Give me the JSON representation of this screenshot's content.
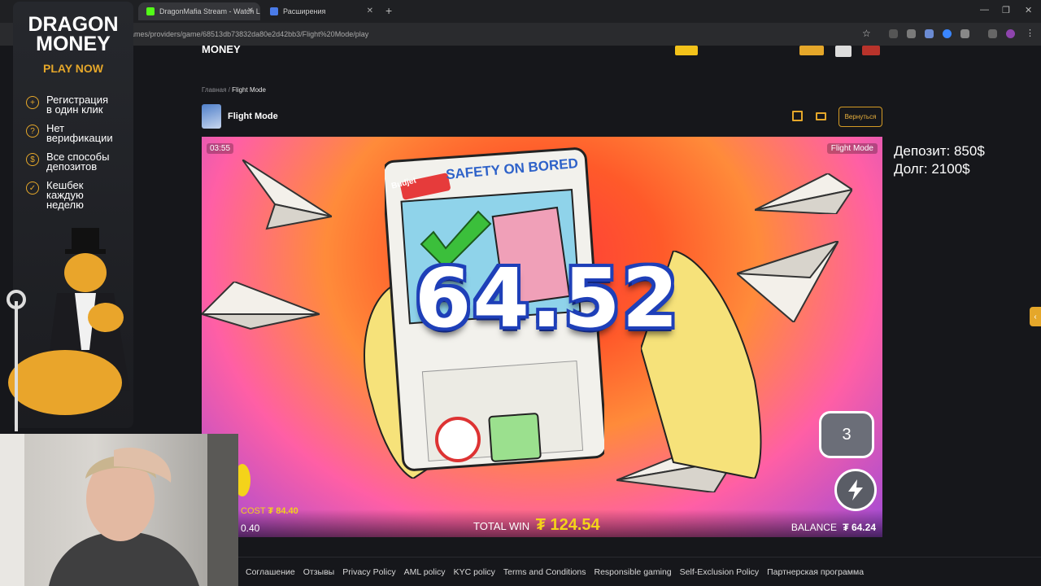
{
  "browser": {
    "tabs": [
      {
        "label": "DragonMafia Stream - Watch L",
        "favicon_color": "#53fc18"
      },
      {
        "label": "Расширения",
        "favicon_color": "#4a7be8"
      }
    ],
    "new_tab": "+",
    "url": "ames/providers/game/68513db73832da80e2d42bb3/Flight%20Mode/play"
  },
  "site": {
    "logo_text": "MONEY",
    "breadcrumb": {
      "home": "Главная",
      "separator": "/",
      "current": "Flight Mode"
    },
    "game_title": "Flight Mode",
    "back_label": "Вернуться",
    "accent": "#e5a72a"
  },
  "game": {
    "timer": "03:55",
    "label": "Flight Mode",
    "card_header": "SAFETY ON BORED",
    "card_brand": "Budjet",
    "multiplier": "64.52",
    "round_count": "3",
    "cost_label": "COST",
    "cost_value": "₮ 84.40",
    "bet_value": "0.40",
    "total_win_label": "TOTAL WIN",
    "total_win_value": "₮ 124.54",
    "balance_label": "BALANCE",
    "balance_value": "₮ 64.24"
  },
  "footer": {
    "links": [
      "Соглашение",
      "Отзывы",
      "Privacy Policy",
      "AML policy",
      "KYC policy",
      "Terms and Conditions",
      "Responsible gaming",
      "Self-Exclusion Policy",
      "Партнерская программа"
    ]
  },
  "overlay": {
    "deposit": "Депозит: 850$",
    "debt": "Долг: 2100$"
  },
  "promo": {
    "logo_line1": "DRAGON",
    "logo_line2": "MONEY",
    "cta": "PLAY NOW",
    "features": [
      {
        "icon": "plus-icon",
        "text": "Регистрация\nв один клик"
      },
      {
        "icon": "question-icon",
        "text": "Нет\nверификации"
      },
      {
        "icon": "coin-icon",
        "text": "Все способы\nдепозитов"
      },
      {
        "icon": "shield-icon",
        "text": "Кешбек\nкаждую\nнеделю"
      }
    ]
  }
}
